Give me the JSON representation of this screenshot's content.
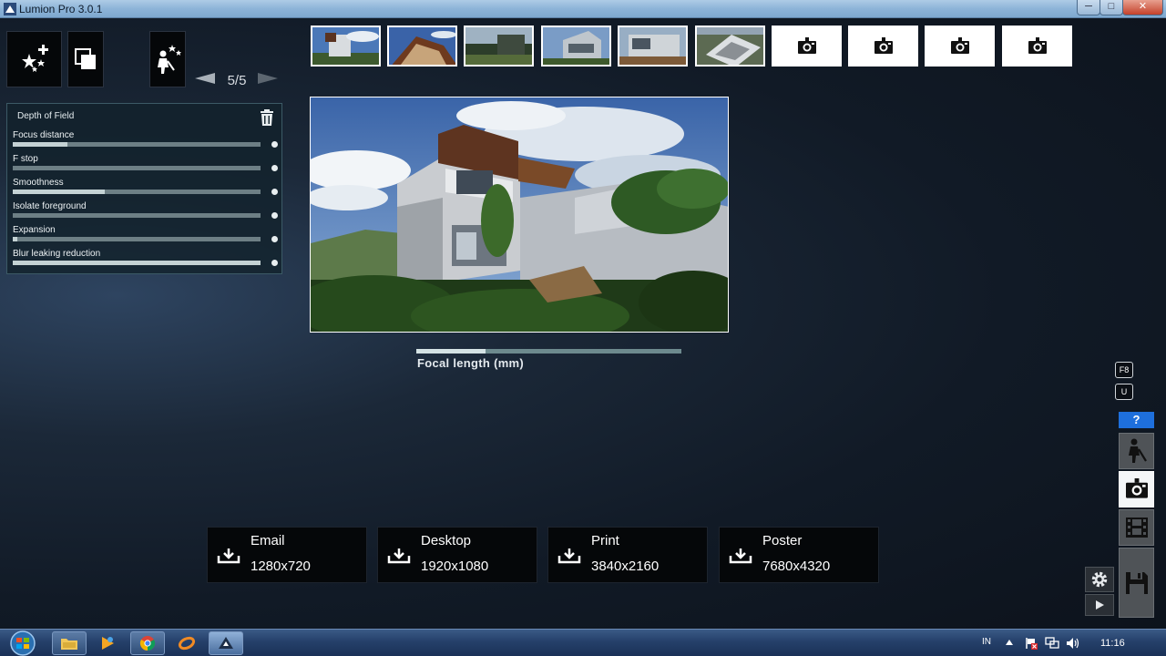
{
  "window": {
    "title": "Lumion Pro  3.0.1",
    "min_label": "─",
    "max_label": "□",
    "close_label": "✕"
  },
  "toolbar": {
    "effects_icon": "stars-plus-icon",
    "copy_icon": "copy-pages-icon",
    "builder_icon": "worker-stars-icon",
    "pager": "5/5"
  },
  "thumbnails": [
    {
      "state": "image",
      "scene": 1
    },
    {
      "state": "image",
      "scene": 2
    },
    {
      "state": "image",
      "scene": 3
    },
    {
      "state": "image",
      "scene": 4
    },
    {
      "state": "image",
      "scene": 5
    },
    {
      "state": "image",
      "scene": 6
    },
    {
      "state": "empty",
      "icon": "camera-icon"
    },
    {
      "state": "empty",
      "icon": "camera-icon"
    },
    {
      "state": "empty",
      "icon": "camera-icon"
    },
    {
      "state": "empty",
      "icon": "camera-icon"
    }
  ],
  "dof_panel": {
    "title": "Depth of Field",
    "sliders": [
      {
        "label": "Focus distance",
        "value": 0.22
      },
      {
        "label": "F stop",
        "value": 0.0
      },
      {
        "label": "Smoothness",
        "value": 0.37
      },
      {
        "label": "Isolate foreground",
        "value": 0.0
      },
      {
        "label": "Expansion",
        "value": 0.02
      },
      {
        "label": "Blur leaking reduction",
        "value": 1.0
      }
    ]
  },
  "focal": {
    "label": "Focal length (mm)",
    "value": 0.26
  },
  "render_buttons": [
    {
      "name": "Email",
      "size": "1280x720"
    },
    {
      "name": "Desktop",
      "size": "1920x1080"
    },
    {
      "name": "Print",
      "size": "3840x2160"
    },
    {
      "name": "Poster",
      "size": "7680x4320"
    }
  ],
  "side": {
    "key_f8": "F8",
    "key_u": "U",
    "help": "?"
  },
  "taskbar": {
    "lang": "IN",
    "time": "11:16"
  },
  "colors": {
    "accent": "#1e6fdc",
    "panel": "#12222c",
    "close": "#c4412b"
  }
}
